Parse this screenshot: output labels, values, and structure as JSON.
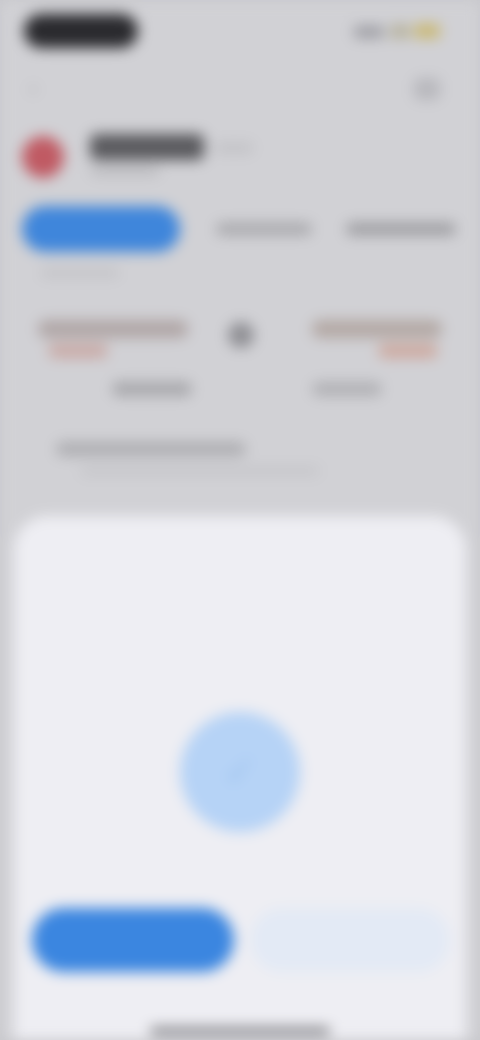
{
  "status_bar": {
    "time": "9:41"
  },
  "coin": {
    "name": "",
    "ticker": ""
  },
  "tabs": [
    {
      "label": ""
    },
    {
      "label": ""
    },
    {
      "label": ""
    }
  ],
  "modal": {
    "title": "",
    "description": "",
    "confirm_label": "",
    "cancel_label": ""
  },
  "colors": {
    "accent": "#3b86e0",
    "accent_light": "#b6d3f6",
    "sheet_bg": "#eeeef3",
    "coin_logo": "#c05a63"
  },
  "icons": {
    "back": "chevron-left-icon",
    "more": "more-icon",
    "swap": "swap-icon",
    "confirm": "check-icon"
  }
}
